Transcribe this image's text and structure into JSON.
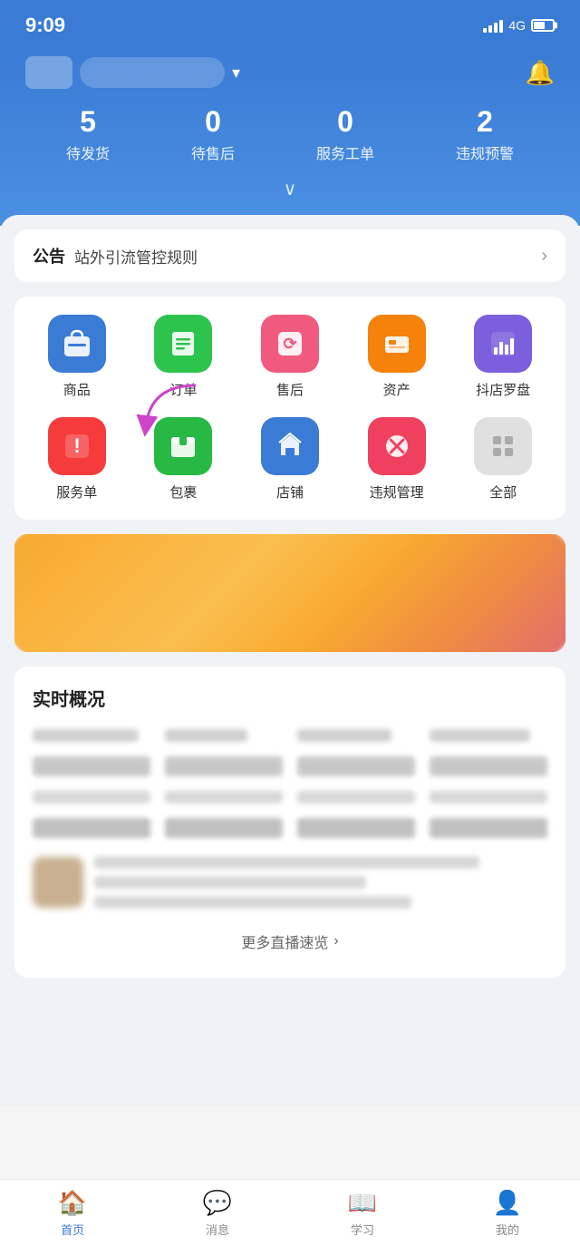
{
  "statusBar": {
    "time": "9:09",
    "network": "4G"
  },
  "header": {
    "storeName": "",
    "chevronLabel": "▾",
    "bellLabel": "🔔",
    "stats": [
      {
        "number": "5",
        "label": "待发货"
      },
      {
        "number": "0",
        "label": "待售后"
      },
      {
        "number": "0",
        "label": "服务工单"
      },
      {
        "number": "2",
        "label": "违规预警"
      }
    ],
    "expandIcon": "∨"
  },
  "announcement": {
    "label": "公告",
    "text": "站外引流管控规则",
    "arrowLabel": "›"
  },
  "menuItems": [
    {
      "label": "商品",
      "iconColor": "icon-blue",
      "iconType": "bag"
    },
    {
      "label": "订单",
      "iconColor": "icon-green",
      "iconType": "order"
    },
    {
      "label": "售后",
      "iconColor": "icon-red-pink",
      "iconType": "aftersale"
    },
    {
      "label": "资产",
      "iconColor": "icon-orange",
      "iconType": "asset"
    },
    {
      "label": "抖店罗盘",
      "iconColor": "icon-purple",
      "iconType": "chart"
    },
    {
      "label": "服务单",
      "iconColor": "icon-red",
      "iconType": "service"
    },
    {
      "label": "包裹",
      "iconColor": "icon-green2",
      "iconType": "package"
    },
    {
      "label": "店铺",
      "iconColor": "icon-blue2",
      "iconType": "store"
    },
    {
      "label": "违规管理",
      "iconColor": "icon-pink-red",
      "iconType": "violation"
    },
    {
      "label": "全部",
      "iconColor": "icon-gray",
      "iconType": "grid"
    }
  ],
  "realtime": {
    "title": "实时概况"
  },
  "moreLive": {
    "text": "更多直播速览",
    "arrow": "›"
  },
  "bottomNav": [
    {
      "label": "首页",
      "iconType": "home",
      "active": true
    },
    {
      "label": "消息",
      "iconType": "message",
      "active": false
    },
    {
      "label": "学习",
      "iconType": "learn",
      "active": false
    },
    {
      "label": "我的",
      "iconType": "profile",
      "active": false
    }
  ]
}
